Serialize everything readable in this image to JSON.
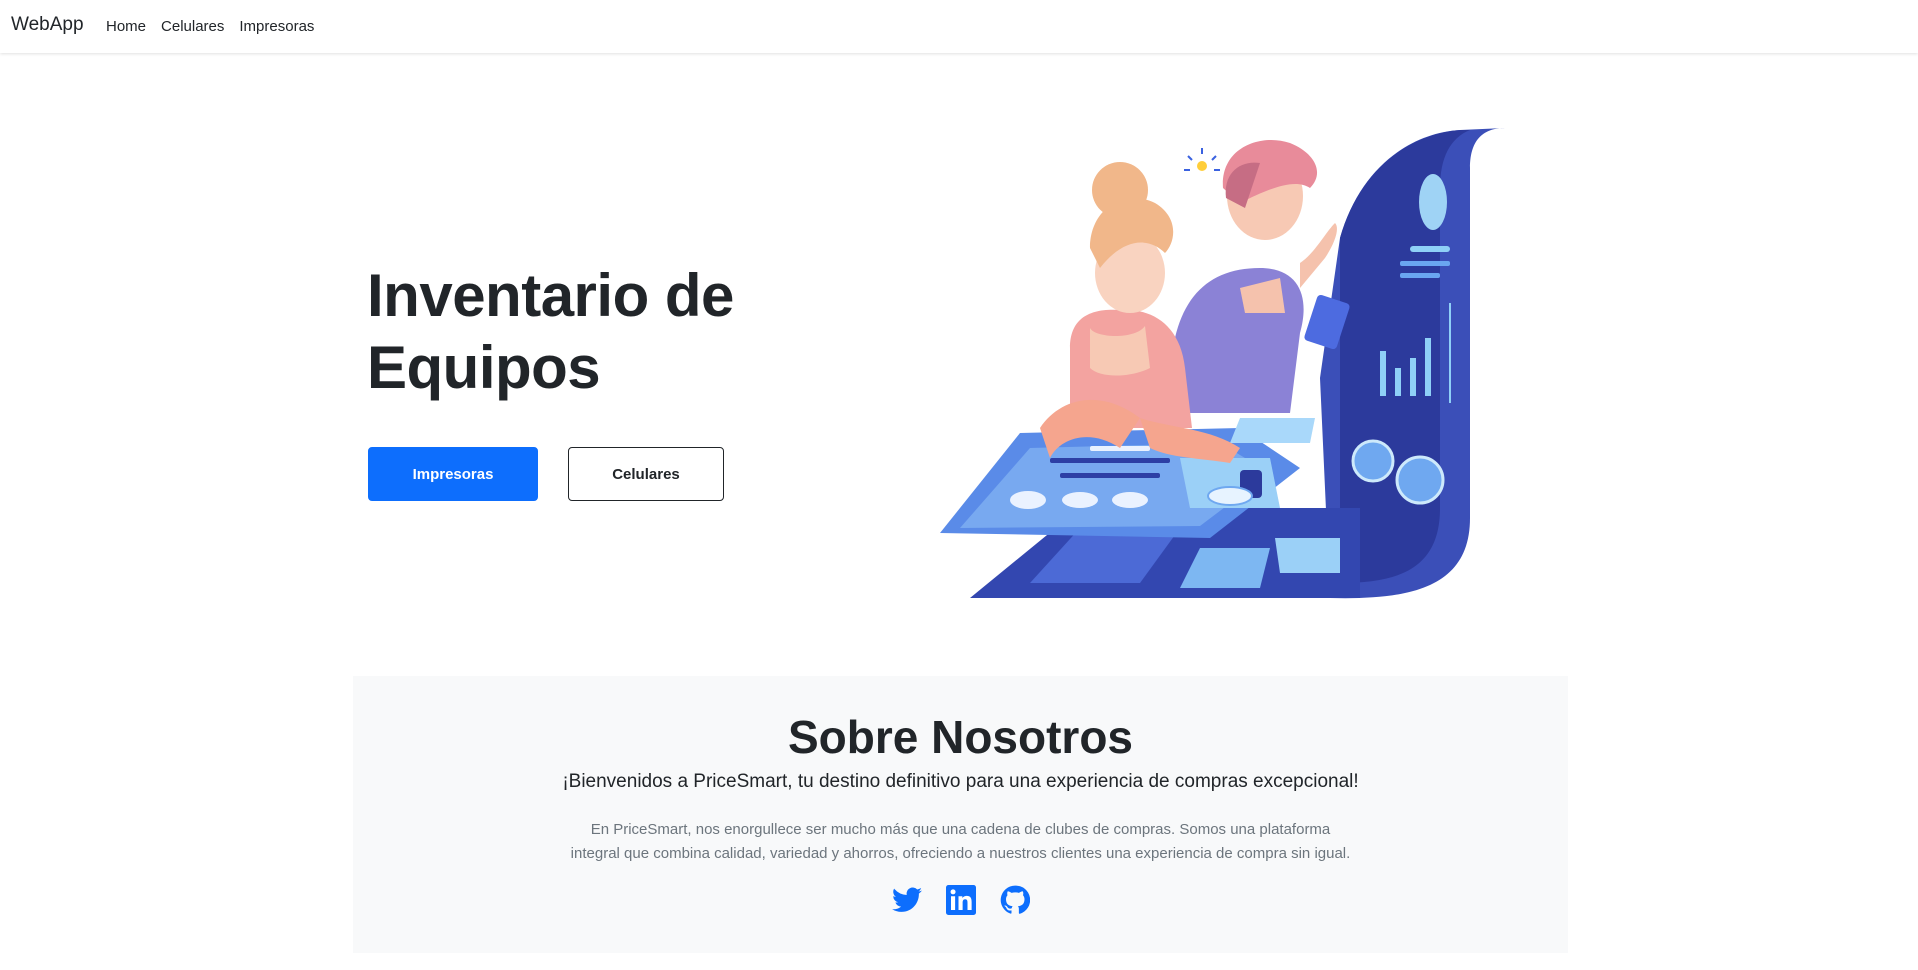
{
  "navbar": {
    "brand": "WebApp",
    "links": [
      "Home",
      "Celulares",
      "Impresoras"
    ]
  },
  "hero": {
    "title": "Inventario de Equipos",
    "primary_button": "Impresoras",
    "secondary_button": "Celulares"
  },
  "about": {
    "title": "Sobre Nosotros",
    "lead": "¡Bienvenidos a PriceSmart, tu destino definitivo para una experiencia de compras excepcional!",
    "body": "En PriceSmart, nos enorgullece ser mucho más que una cadena de clubes de compras. Somos una plataforma integral que combina calidad, variedad y ahorros, ofreciendo a nuestros clientes una experiencia de compra sin igual.",
    "social_icons": [
      "twitter-icon",
      "linkedin-icon",
      "github-icon"
    ]
  },
  "colors": {
    "primary": "#0d6efd",
    "about_bg": "#f8f9fa",
    "text": "#212529",
    "muted": "#6c757d"
  }
}
